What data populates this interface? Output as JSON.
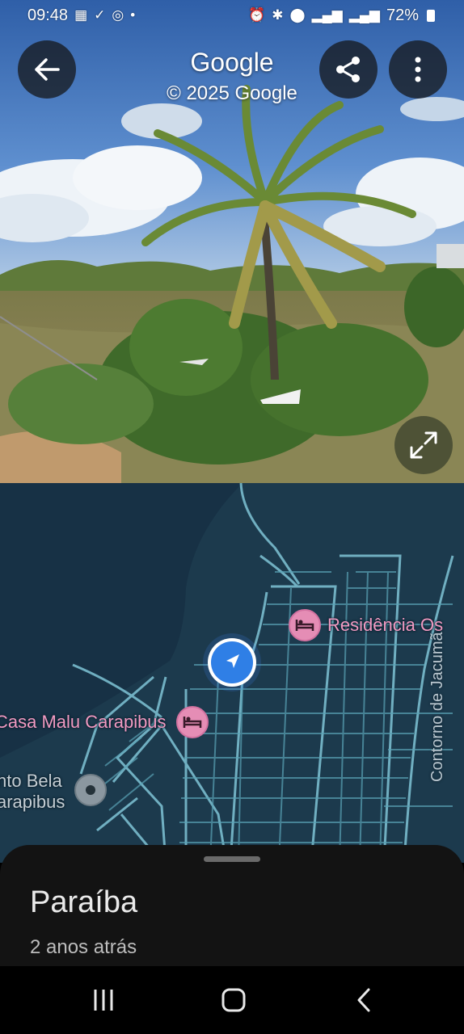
{
  "status_bar": {
    "time": "09:48",
    "battery": "72%"
  },
  "header": {
    "title": "Google",
    "copyright": "© 2025 Google"
  },
  "icons": {
    "back": "arrow-left-icon",
    "share": "share-icon",
    "more": "more-vert-icon",
    "expand": "expand-icon"
  },
  "map": {
    "pois": [
      {
        "label": "Residência Os",
        "type": "hotel"
      },
      {
        "label": "Casa Malu Carapibus",
        "type": "hotel"
      },
      {
        "label_line1": "nto Bela",
        "label_line2": "arapibus",
        "type": "place"
      }
    ],
    "street": "Contorno de Jacumã"
  },
  "sheet": {
    "title": "Paraíba",
    "subtitle": "2 anos atrás"
  },
  "nav": {
    "recents": "recents-icon",
    "home": "home-icon",
    "back": "back-icon"
  }
}
